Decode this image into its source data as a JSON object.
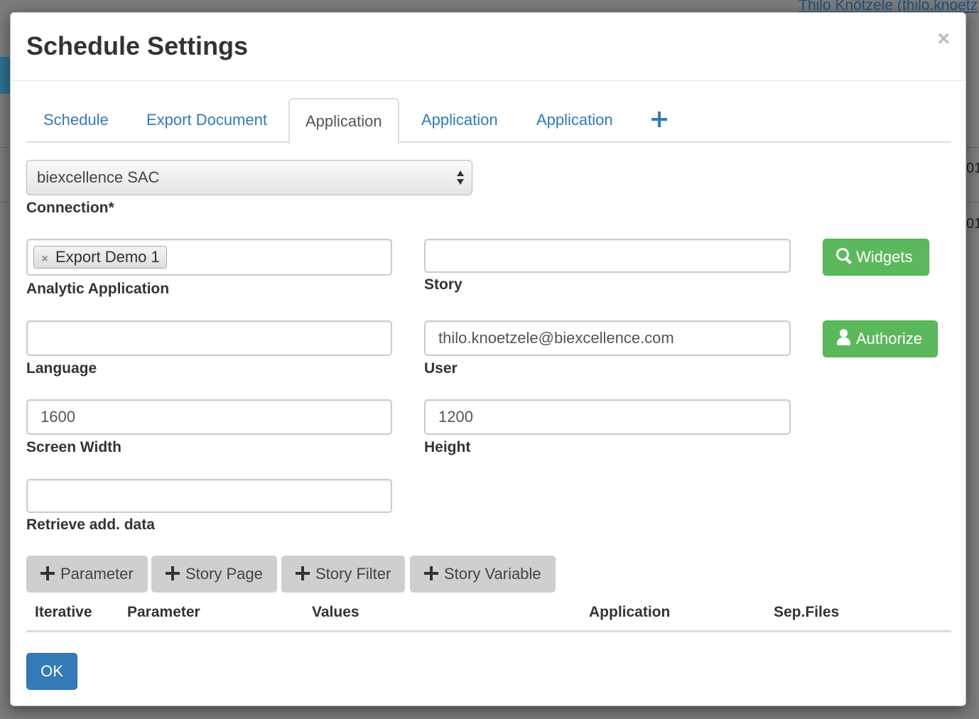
{
  "background": {
    "user_text": "Thilo Knötzele (thilo.knoetz",
    "right_fragment_1": "01",
    "right_fragment_2": "01"
  },
  "modal": {
    "title": "Schedule Settings",
    "close_symbol": "×"
  },
  "tabs": [
    {
      "label": "Schedule",
      "active": false
    },
    {
      "label": "Export Document",
      "active": false
    },
    {
      "label": "Application",
      "active": true
    },
    {
      "label": "Application",
      "active": false
    },
    {
      "label": "Application",
      "active": false
    }
  ],
  "add_tab_icon": "plus-icon",
  "connection": {
    "value": "biexcellence SAC",
    "label": "Connection*"
  },
  "analytic_application": {
    "chip": "Export Demo 1",
    "chip_remove": "×",
    "label": "Analytic Application"
  },
  "story": {
    "value": "",
    "label": "Story"
  },
  "widgets_button": {
    "label": "Widgets",
    "icon": "search-icon"
  },
  "language": {
    "value": "",
    "label": "Language"
  },
  "user": {
    "value": "thilo.knoetzele@biexcellence.com",
    "label": "User"
  },
  "authorize_button": {
    "label": "Authorize",
    "icon": "user-icon"
  },
  "screen_width": {
    "value": "1600",
    "label": "Screen Width"
  },
  "height": {
    "value": "1200",
    "label": "Height"
  },
  "retrieve": {
    "value": "",
    "label": "Retrieve add. data"
  },
  "add_buttons": [
    {
      "label": "Parameter"
    },
    {
      "label": "Story Page"
    },
    {
      "label": "Story Filter"
    },
    {
      "label": "Story Variable"
    }
  ],
  "table": {
    "headers": [
      "Iterative",
      "Parameter",
      "Values",
      "Application",
      "Sep.Files"
    ]
  },
  "ok_button": {
    "label": "OK"
  },
  "colors": {
    "primary": "#337ab7",
    "success": "#5cb85c",
    "default_button": "#cfcfcf"
  }
}
